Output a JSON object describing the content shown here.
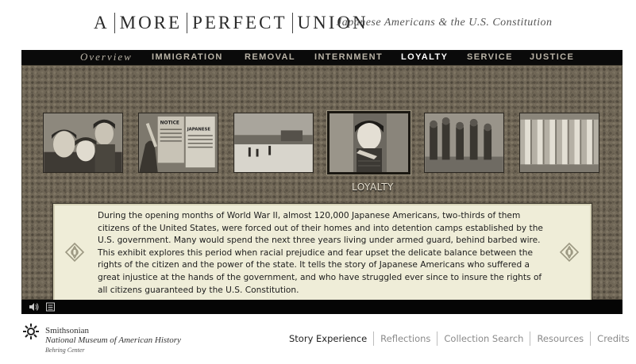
{
  "header": {
    "title_parts": [
      "A",
      "MORE",
      "PERFECT",
      "UNION"
    ],
    "subtitle": "Japanese Americans & the U.S. Constitution"
  },
  "nav": {
    "items": [
      {
        "label": "Overview",
        "style": "italic",
        "active": false
      },
      {
        "label": "IMMIGRATION",
        "active": false
      },
      {
        "label": "REMOVAL",
        "active": false
      },
      {
        "label": "INTERNMENT",
        "active": false
      },
      {
        "label": "LOYALTY",
        "active": true
      },
      {
        "label": "SERVICE",
        "active": false
      },
      {
        "label": "JUSTICE",
        "active": false
      }
    ]
  },
  "thumbnails": {
    "selected_caption": "LOYALTY",
    "items": [
      {
        "subject": "children-photo",
        "selected": false
      },
      {
        "subject": "posted-notice-photo",
        "notice_texts": [
          "NOTICE",
          "JAPANESE"
        ],
        "selected": false
      },
      {
        "subject": "camp-landscape-photo",
        "selected": false
      },
      {
        "subject": "girl-pledge-photo",
        "selected": true
      },
      {
        "subject": "soldiers-marching-photo",
        "selected": false
      },
      {
        "subject": "supreme-court-columns-photo",
        "selected": false
      }
    ]
  },
  "panel": {
    "text": "During the opening months of World War II, almost 120,000 Japanese Americans, two-thirds of them citizens of the United States, were forced out of their homes and into detention camps established by the U.S. government. Many would spend the next three years living under armed guard, behind barbed wire. This exhibit explores this period when racial prejudice and fear upset the delicate balance between the rights of the citizen and the power of the state. It tells the story of Japanese Americans who suffered a great injustice at the hands of the government, and who have struggled ever since to insure the rights of all citizens guaranteed by the U.S. Constitution."
  },
  "controls": {
    "icons": [
      "speaker-icon",
      "transcript-icon"
    ]
  },
  "footer": {
    "museum_line1": "Smithsonian",
    "museum_line2": "National Museum of American History",
    "museum_line3": "Behring Center",
    "links": [
      {
        "label": "Story Experience",
        "active": true
      },
      {
        "label": "Reflections",
        "active": false
      },
      {
        "label": "Collection Search",
        "active": false
      },
      {
        "label": "Resources",
        "active": false
      },
      {
        "label": "Credits",
        "active": false
      }
    ]
  },
  "colors": {
    "nav_active": "#ffffff",
    "nav_inactive": "#b9b3a6",
    "panel_bg": "#efedd8",
    "stage_bg": "#6f6656"
  }
}
